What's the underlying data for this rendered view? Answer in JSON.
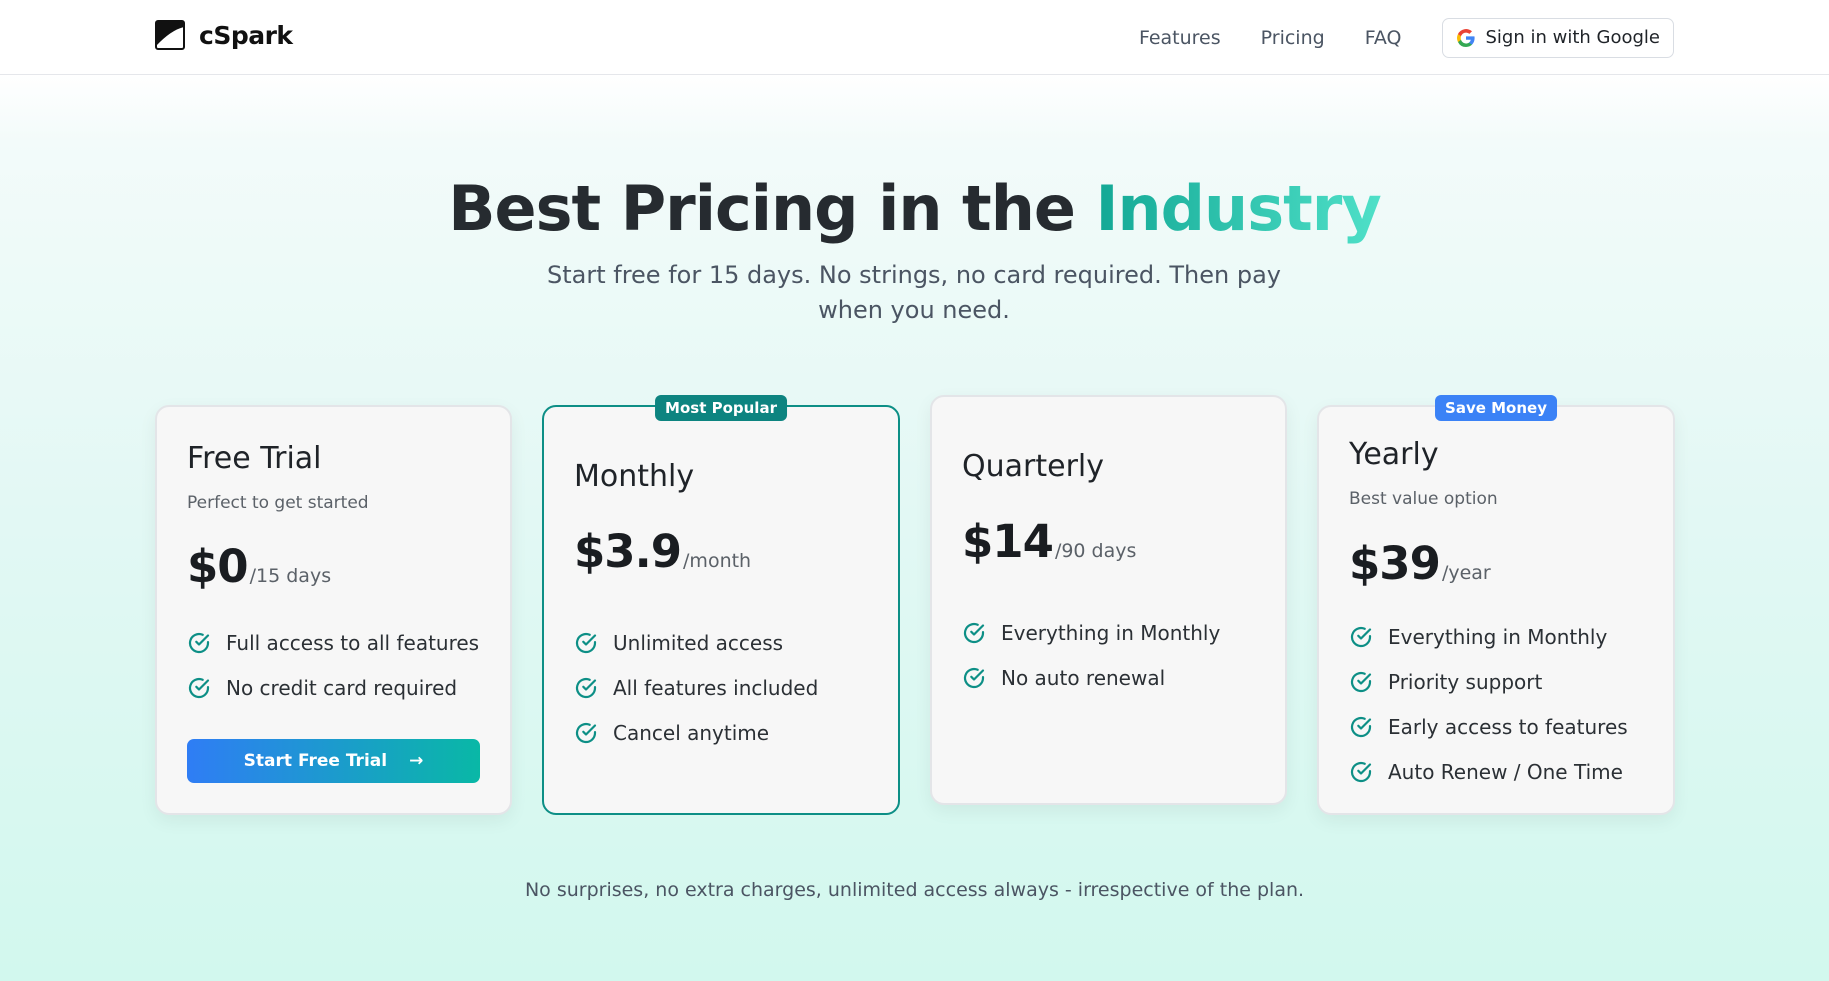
{
  "brand": {
    "name": "cSpark"
  },
  "nav": {
    "links": [
      "Features",
      "Pricing",
      "FAQ"
    ],
    "signin_label": "Sign in with Google"
  },
  "hero": {
    "title_main": "Best Pricing in the ",
    "title_accent": "Industry",
    "subtitle": "Start free for 15 days. No strings, no card required. Then pay when you need."
  },
  "plans": [
    {
      "name": "Free Trial",
      "desc": "Perfect to get started",
      "price": "$0",
      "period": "/15 days",
      "features": [
        "Full access to all features",
        "No credit card required"
      ],
      "cta": "Start Free Trial",
      "cta_arrow": "→"
    },
    {
      "name": "Monthly",
      "badge": "Most Popular",
      "price": "$3.9",
      "period": "/month",
      "features": [
        "Unlimited access",
        "All features included",
        "Cancel anytime"
      ]
    },
    {
      "name": "Quarterly",
      "price": "$14",
      "period": "/90 days",
      "features": [
        "Everything in Monthly",
        "No auto renewal"
      ]
    },
    {
      "name": "Yearly",
      "badge": "Save Money",
      "desc": "Best value option",
      "price": "$39",
      "period": "/year",
      "features": [
        "Everything in Monthly",
        "Priority support",
        "Early access to features",
        "Auto Renew / One Time"
      ]
    }
  ],
  "footer_note": "No surprises, no extra charges, unlimited access always - irrespective of the plan.",
  "colors": {
    "accent_teal": "#0d8f86",
    "badge_blue": "#3b82f6",
    "cta_gradient_start": "#2f7df5",
    "cta_gradient_end": "#09b8a6"
  }
}
